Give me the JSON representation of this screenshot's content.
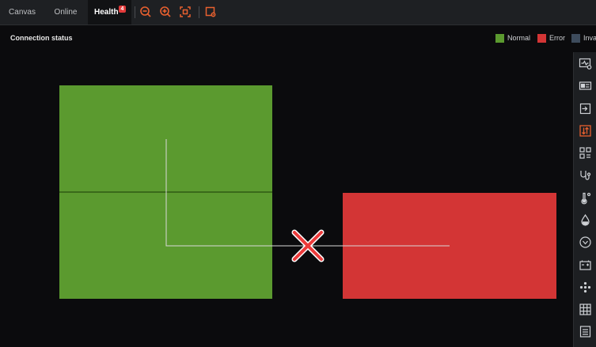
{
  "tabs": [
    {
      "label": "Canvas",
      "active": false
    },
    {
      "label": "Online",
      "active": false
    },
    {
      "label": "Health",
      "active": true,
      "badge": "4"
    }
  ],
  "toolbar": {
    "icons": [
      "zoom-out-icon",
      "zoom-in-icon",
      "fit-screen-icon",
      "export-icon"
    ]
  },
  "canvas": {
    "title": "Connection status",
    "legend": [
      {
        "label": "Normal",
        "color": "#5b9a2f"
      },
      {
        "label": "Error",
        "color": "#d33535"
      },
      {
        "label": "Inval",
        "color": "#3d4b5c"
      }
    ],
    "nodes": [
      {
        "status": "normal",
        "color": "#5b9a2f"
      },
      {
        "status": "error",
        "color": "#d33535"
      }
    ],
    "link_status": "error"
  },
  "rightbar": {
    "icons": [
      "monitor-settings-icon",
      "device-card-icon",
      "login-icon",
      "data-exchange-icon",
      "grid-scan-icon",
      "link-icon",
      "temperature-icon",
      "humidity-icon",
      "chevron-circle-icon",
      "battery-icon",
      "fan-icon",
      "keypad-icon",
      "list-icon"
    ],
    "active": "data-exchange-icon"
  }
}
